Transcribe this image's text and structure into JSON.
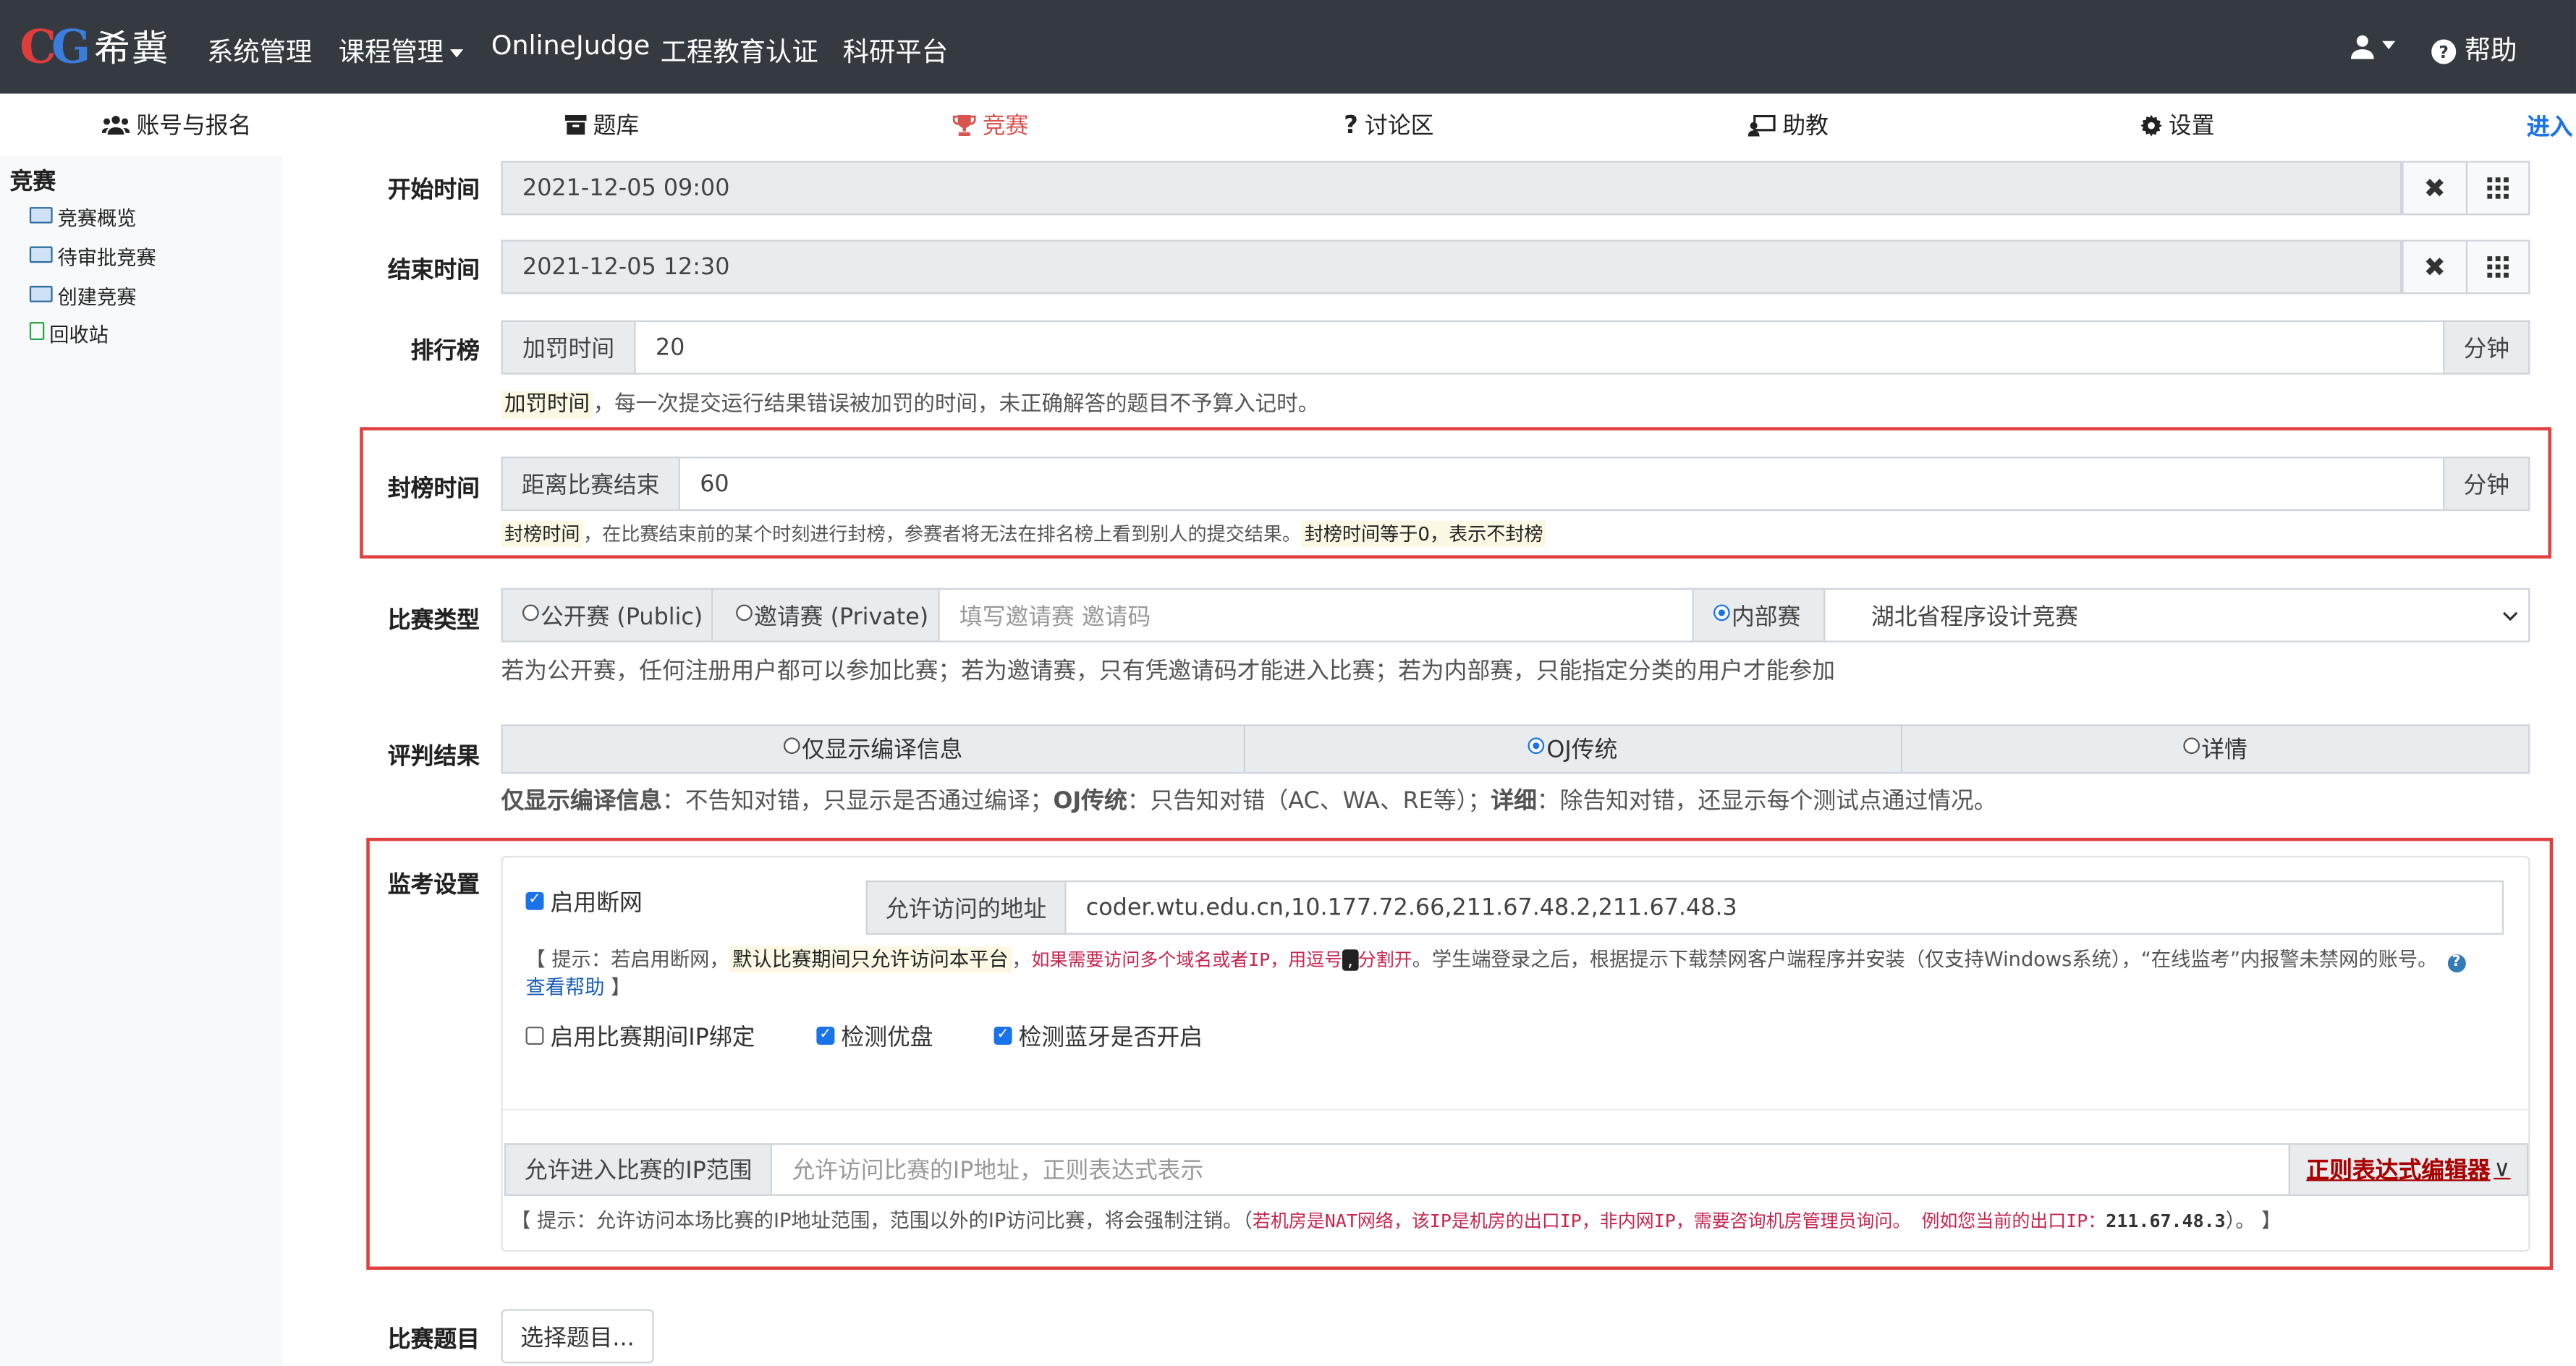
{
  "navbar": {
    "logo_letters_1": "C",
    "logo_letters_2": "G",
    "brand": "希冀",
    "items": [
      "系统管理",
      "课程管理",
      "OnlineJudge",
      "工程教育认证",
      "科研平台"
    ],
    "help": "帮助",
    "user_icon": "user-icon",
    "help_icon": "question-circle-icon"
  },
  "tabs": [
    {
      "label": "账号与报名",
      "icon": "users-icon",
      "active": false
    },
    {
      "label": "题库",
      "icon": "archive-icon",
      "active": false
    },
    {
      "label": "竞赛",
      "icon": "trophy-icon",
      "active": true
    },
    {
      "label": "讨论区",
      "icon": "question-icon",
      "active": false
    },
    {
      "label": "助教",
      "icon": "assistant-icon",
      "active": false
    },
    {
      "label": "设置",
      "icon": "gear-icon",
      "active": false
    }
  ],
  "enter_link": "进入",
  "sidebar": {
    "title": "竞赛",
    "items": [
      "竞赛概览",
      "待审批竞赛",
      "创建竞赛",
      "回收站"
    ]
  },
  "form": {
    "start_time": {
      "label": "开始时间",
      "value": "2021-12-05 09:00"
    },
    "end_time": {
      "label": "结束时间",
      "value": "2021-12-05 12:30"
    },
    "ranking": {
      "label": "排行榜",
      "addon": "加罚时间",
      "value": "20",
      "unit": "分钟",
      "help_highlight": "加罚时间",
      "help_text": "，每一次提交运行结果错误被加罚的时间，未正确解答的题目不予算入记时。"
    },
    "freeze": {
      "label": "封榜时间",
      "addon": "距离比赛结束",
      "value": "60",
      "unit": "分钟",
      "help_highlight1": "封榜时间",
      "help_text": "，在比赛结束前的某个时刻进行封榜，参赛者将无法在排名榜上看到别人的提交结果。",
      "help_highlight2": "封榜时间等于0，表示不封榜"
    },
    "contest_type": {
      "label": "比赛类型",
      "opt_public": "公开赛 (Public)",
      "opt_private": "邀请赛 (Private)",
      "invite_placeholder": "填写邀请赛 邀请码",
      "opt_internal": "内部赛",
      "category": "湖北省程序设计竞赛",
      "selected": "内部赛",
      "help": "若为公开赛，任何注册用户都可以参加比赛；若为邀请赛，只有凭邀请码才能进入比赛；若为内部赛，只能指定分类的用户才能参加"
    },
    "judge_result": {
      "label": "评判结果",
      "options": [
        "仅显示编译信息",
        "OJ传统",
        "详情"
      ],
      "selected": "OJ传统",
      "help_b1": "仅显示编译信息",
      "help_t1": "：不告知对错，只显示是否通过编译；",
      "help_b2": "OJ传统",
      "help_t2": "：只告知对错（AC、WA、RE等）；",
      "help_b3": "详细",
      "help_t3": "：除告知对错，还显示每个测试点通过情况。"
    },
    "proctor": {
      "label": "监考设置",
      "enable_network_cut": "启用断网",
      "enable_network_cut_checked": true,
      "allowed_addr_label": "允许访问的地址",
      "allowed_addr_value": "coder.wtu.edu.cn,10.177.72.66,211.67.48.2,211.67.48.3",
      "tip_prefix": "【 提示：若启用断网，",
      "tip_highlight": "默认比赛期间只允许访问本平台",
      "tip_comma": "，",
      "tip_mono1": "如果需要访问多个域名或者IP，用逗号",
      "tip_comma_mark": ",",
      "tip_mono2": "分割开",
      "tip_rest": "。学生端登录之后，根据提示下载禁网客户端程序并安装（仅支持Windows系统），“在线监考”内报警未禁网的账号。",
      "tip_link": "查看帮助",
      "tip_close": " 】",
      "ip_bind": "启用比赛期间IP绑定",
      "ip_bind_checked": false,
      "detect_usb": "检测优盘",
      "detect_usb_checked": true,
      "detect_bt": "检测蓝牙是否开启",
      "detect_bt_checked": true,
      "ip_range_label": "允许进入比赛的IP范围",
      "ip_range_placeholder": "允许访问比赛的IP地址，正则表达式表示",
      "regex_editor": "正则表达式编辑器",
      "ip_tip_prefix": "【 提示：允许访问本场比赛的IP地址范围，范围以外的IP访问比赛，将会强制注销。（",
      "ip_tip_mono": "若机房是NAT网络，该IP是机房的出口IP，非内网IP，需要咨询机房管理员询问。 例如您当前的出口IP：",
      "ip_tip_ip": "211.67.48.3",
      "ip_tip_suffix": "）。 】"
    },
    "problems": {
      "label": "比赛题目",
      "button": "选择题目..."
    }
  }
}
